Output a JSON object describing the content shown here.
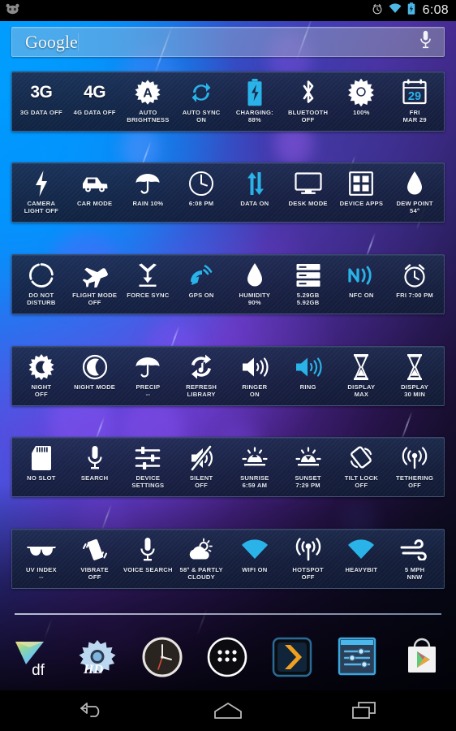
{
  "status_bar": {
    "mascot_icon": "android-mascot-icon",
    "icons": [
      "alarm-icon",
      "wifi-icon",
      "battery-charging-icon"
    ],
    "time": "6:08"
  },
  "search": {
    "label": "Google",
    "placeholder": "Google",
    "mic_icon": "microphone-icon"
  },
  "widget_rows": [
    {
      "row": 1,
      "tiles": [
        {
          "icon": "3g-text-icon",
          "glyph": "3G",
          "label": "3G DATA OFF"
        },
        {
          "icon": "4g-text-icon",
          "glyph": "4G",
          "label": "4G DATA OFF"
        },
        {
          "icon": "auto-brightness-icon",
          "label": "AUTO\nBRIGHTNESS"
        },
        {
          "icon": "auto-sync-icon",
          "label": "AUTO SYNC\nON"
        },
        {
          "icon": "battery-charging-icon",
          "label": "CHARGING:\n88%"
        },
        {
          "icon": "bluetooth-icon",
          "label": "BLUETOOTH\nOFF"
        },
        {
          "icon": "brightness-sun-icon",
          "label": "100%"
        },
        {
          "icon": "calendar-icon",
          "glyph": "29",
          "label": "FRI\nMAR 29"
        }
      ]
    },
    {
      "row": 2,
      "tiles": [
        {
          "icon": "camera-flash-icon",
          "label": "CAMERA\nLIGHT OFF"
        },
        {
          "icon": "car-icon",
          "label": "CAR MODE"
        },
        {
          "icon": "umbrella-icon",
          "label": "RAIN 10%"
        },
        {
          "icon": "clock-face-icon",
          "label": "6:08 PM"
        },
        {
          "icon": "data-transfer-icon",
          "label": "DATA ON"
        },
        {
          "icon": "monitor-icon",
          "label": "DESK MODE"
        },
        {
          "icon": "apps-grid-icon",
          "label": "DEVICE APPS"
        },
        {
          "icon": "water-drop-icon",
          "label": "DEW POINT\n54°"
        }
      ]
    },
    {
      "row": 3,
      "tiles": [
        {
          "icon": "do-not-disturb-icon",
          "label": "DO NOT\nDISTURB"
        },
        {
          "icon": "airplane-icon",
          "label": "FLIGHT MODE\nOFF"
        },
        {
          "icon": "force-sync-icon",
          "label": "FORCE SYNC"
        },
        {
          "icon": "gps-icon",
          "label": "GPS ON"
        },
        {
          "icon": "water-drop-icon",
          "label": "HUMIDITY\n90%"
        },
        {
          "icon": "storage-icon",
          "label": "5.29GB\n5.92GB"
        },
        {
          "icon": "nfc-icon",
          "label": "NFC ON"
        },
        {
          "icon": "alarm-clock-icon",
          "label": "FRI 7:00 PM"
        }
      ]
    },
    {
      "row": 4,
      "tiles": [
        {
          "icon": "night-sun-moon-icon",
          "label": "NIGHT\nOFF"
        },
        {
          "icon": "moon-circle-icon",
          "label": "NIGHT MODE"
        },
        {
          "icon": "umbrella-icon",
          "label": "PRECIP\n--"
        },
        {
          "icon": "refresh-music-icon",
          "label": "REFRESH\nLIBRARY"
        },
        {
          "icon": "speaker-on-icon",
          "label": "RINGER\nON"
        },
        {
          "icon": "speaker-ring-icon",
          "label": "RING"
        },
        {
          "icon": "hourglass-icon",
          "label": "DISPLAY\nMAX"
        },
        {
          "icon": "hourglass-icon",
          "label": "DISPLAY\n30 MIN"
        }
      ]
    },
    {
      "row": 5,
      "tiles": [
        {
          "icon": "sd-card-icon",
          "label": "NO SLOT"
        },
        {
          "icon": "microphone-icon",
          "label": "SEARCH"
        },
        {
          "icon": "sliders-icon",
          "label": "DEVICE\nSETTINGS"
        },
        {
          "icon": "speaker-mute-icon",
          "label": "SILENT\nOFF"
        },
        {
          "icon": "sunrise-icon",
          "label": "SUNRISE\n6:59 AM"
        },
        {
          "icon": "sunset-icon",
          "label": "SUNSET\n7:29 PM"
        },
        {
          "icon": "rotation-lock-icon",
          "label": "TILT LOCK\nOFF"
        },
        {
          "icon": "tethering-icon",
          "label": "TETHERING\nOFF"
        }
      ]
    },
    {
      "row": 6,
      "tiles": [
        {
          "icon": "sunglasses-icon",
          "label": "UV INDEX\n--"
        },
        {
          "icon": "vibrate-icon",
          "label": "VIBRATE\nOFF"
        },
        {
          "icon": "microphone-icon",
          "label": "VOICE SEARCH"
        },
        {
          "icon": "partly-cloudy-icon",
          "label": "58° & PARTLY\nCLOUDY"
        },
        {
          "icon": "wifi-icon",
          "label": "WIFI ON"
        },
        {
          "icon": "hotspot-icon",
          "label": "HOTSPOT\nOFF"
        },
        {
          "icon": "wifi-icon",
          "label": "HEAVYBIT"
        },
        {
          "icon": "wind-icon",
          "label": "5 MPH\nNNW"
        }
      ]
    }
  ],
  "dock": {
    "items": [
      {
        "icon": "dashclock-icon",
        "name": "df"
      },
      {
        "icon": "settings-hd-icon",
        "name": "HD"
      },
      {
        "icon": "clock-icon",
        "name": "Clock"
      },
      {
        "icon": "app-drawer-icon",
        "name": "Apps"
      },
      {
        "icon": "plex-icon",
        "name": "Plex"
      },
      {
        "icon": "tasker-settings-icon",
        "name": "Settings"
      },
      {
        "icon": "play-store-icon",
        "name": "Play Store"
      }
    ]
  },
  "nav_bar": {
    "buttons": [
      {
        "icon": "back-icon",
        "name": "Back"
      },
      {
        "icon": "home-icon",
        "name": "Home"
      },
      {
        "icon": "recents-icon",
        "name": "Recents"
      }
    ]
  },
  "colors": {
    "accent_cyan": "#29b6f6",
    "tile_bg": "#1a2748",
    "wallpaper_blue": "#0093ff",
    "wallpaper_purple": "#5a2fae",
    "text": "#e3e9f2"
  }
}
